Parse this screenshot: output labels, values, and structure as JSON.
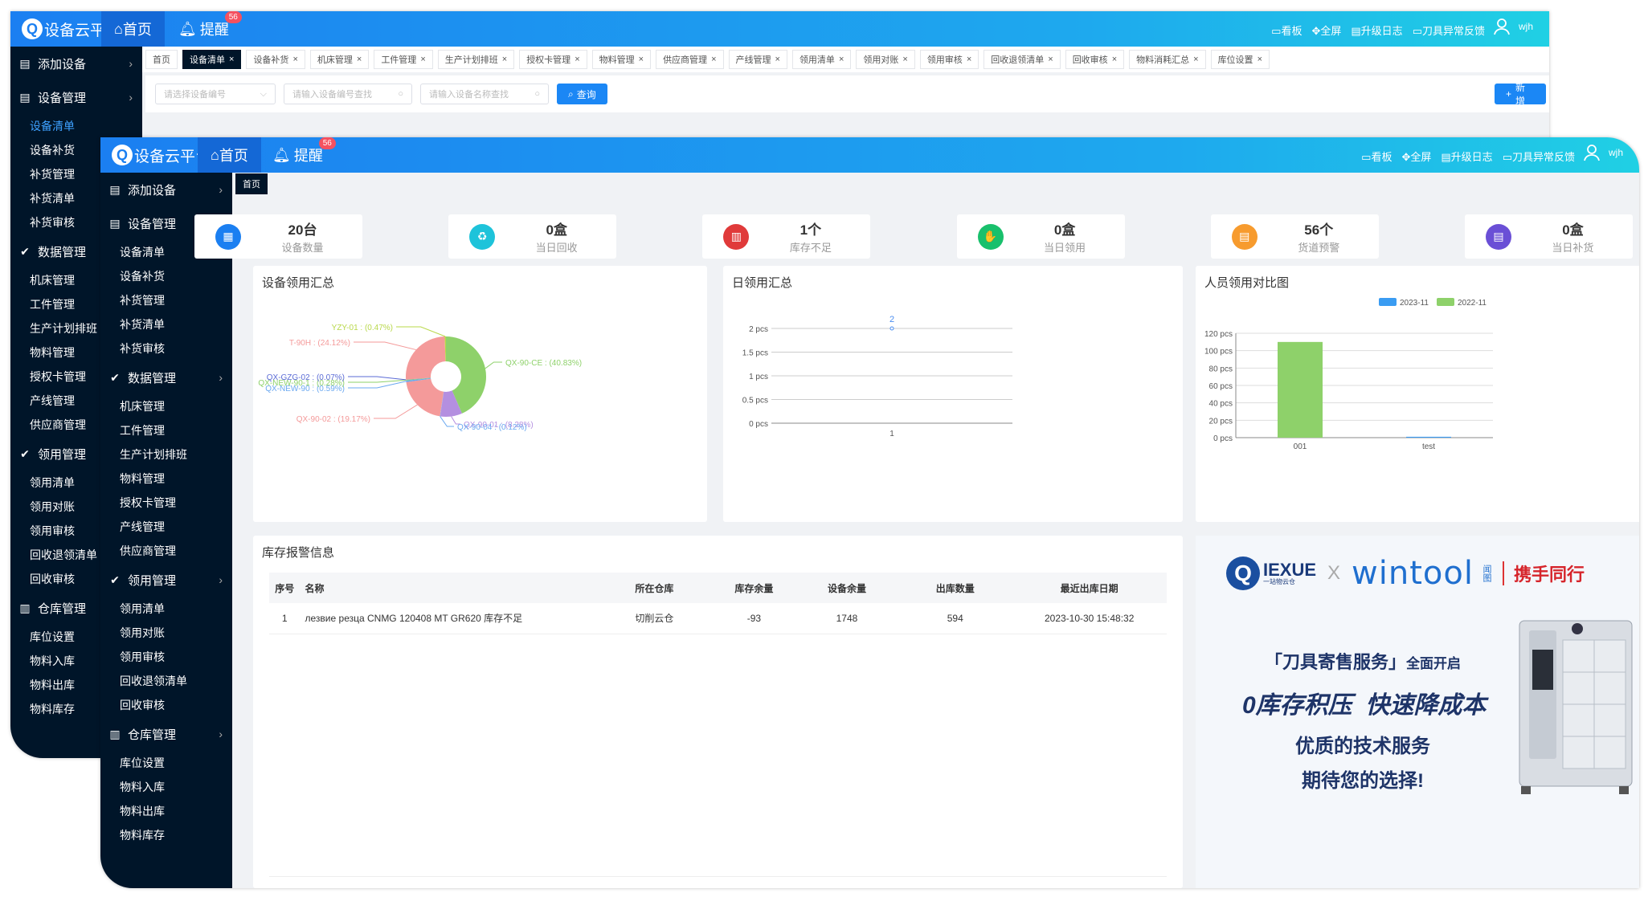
{
  "brand": {
    "name": "设备云平台",
    "home": "首页",
    "remind": "提醒",
    "remind_count": "56"
  },
  "toolbar": {
    "board": "看板",
    "fullscreen": "全屏",
    "log": "升级日志",
    "feedback": "刀具异常反馈",
    "user": "wjh"
  },
  "back_sidebar": [
    {
      "t": "group",
      "icon": "doc",
      "label": "添加设备",
      "chev": "›"
    },
    {
      "t": "group",
      "icon": "doc",
      "label": "设备管理",
      "chev": "›"
    },
    {
      "t": "child",
      "label": "设备清单",
      "active": true
    },
    {
      "t": "child",
      "label": "设备补货"
    },
    {
      "t": "child",
      "label": "补货管理"
    },
    {
      "t": "child",
      "label": "补货清单"
    },
    {
      "t": "child",
      "label": "补货审核"
    },
    {
      "t": "group",
      "icon": "check",
      "label": "数据管理"
    },
    {
      "t": "child",
      "label": "机床管理"
    },
    {
      "t": "child",
      "label": "工件管理"
    },
    {
      "t": "child",
      "label": "生产计划排班"
    },
    {
      "t": "child",
      "label": "物料管理"
    },
    {
      "t": "child",
      "label": "授权卡管理"
    },
    {
      "t": "child",
      "label": "产线管理"
    },
    {
      "t": "child",
      "label": "供应商管理"
    },
    {
      "t": "group",
      "icon": "check",
      "label": "领用管理"
    },
    {
      "t": "child",
      "label": "领用清单"
    },
    {
      "t": "child",
      "label": "领用对账"
    },
    {
      "t": "child",
      "label": "领用审核"
    },
    {
      "t": "child",
      "label": "回收退领清单"
    },
    {
      "t": "child",
      "label": "回收审核"
    },
    {
      "t": "group",
      "icon": "bank",
      "label": "仓库管理"
    },
    {
      "t": "child",
      "label": "库位设置"
    },
    {
      "t": "child",
      "label": "物料入库"
    },
    {
      "t": "child",
      "label": "物料出库"
    },
    {
      "t": "child",
      "label": "物料库存"
    }
  ],
  "back_tabs": [
    {
      "l": "首页",
      "x": false
    },
    {
      "l": "设备清单",
      "x": true,
      "active": true
    },
    {
      "l": "设备补货",
      "x": true
    },
    {
      "l": "机床管理",
      "x": true
    },
    {
      "l": "工件管理",
      "x": true
    },
    {
      "l": "生产计划排班",
      "x": true
    },
    {
      "l": "授权卡管理",
      "x": true
    },
    {
      "l": "物料管理",
      "x": true
    },
    {
      "l": "供应商管理",
      "x": true
    },
    {
      "l": "产线管理",
      "x": true
    },
    {
      "l": "领用清单",
      "x": true
    },
    {
      "l": "领用对账",
      "x": true
    },
    {
      "l": "领用审核",
      "x": true
    },
    {
      "l": "回收退领清单",
      "x": true
    },
    {
      "l": "回收审核",
      "x": true
    },
    {
      "l": "物料消耗汇总",
      "x": true
    },
    {
      "l": "库位设置",
      "x": true
    }
  ],
  "filter": {
    "device_select": "请选择设备编号",
    "device_no": "请输入设备编号查找",
    "device_name": "请输入设备名称查找",
    "query": "查询",
    "add": "新增"
  },
  "front_sidebar": [
    {
      "t": "group",
      "icon": "doc",
      "label": "添加设备",
      "chev": "›"
    },
    {
      "t": "group",
      "icon": "doc",
      "label": "设备管理",
      "chev": "›"
    },
    {
      "t": "child",
      "label": "设备清单"
    },
    {
      "t": "child",
      "label": "设备补货"
    },
    {
      "t": "child",
      "label": "补货管理"
    },
    {
      "t": "child",
      "label": "补货清单"
    },
    {
      "t": "child",
      "label": "补货审核"
    },
    {
      "t": "group",
      "icon": "check",
      "label": "数据管理",
      "chev": "›"
    },
    {
      "t": "child",
      "label": "机床管理"
    },
    {
      "t": "child",
      "label": "工件管理"
    },
    {
      "t": "child",
      "label": "生产计划排班"
    },
    {
      "t": "child",
      "label": "物料管理"
    },
    {
      "t": "child",
      "label": "授权卡管理"
    },
    {
      "t": "child",
      "label": "产线管理"
    },
    {
      "t": "child",
      "label": "供应商管理"
    },
    {
      "t": "group",
      "icon": "check",
      "label": "领用管理",
      "chev": "›"
    },
    {
      "t": "child",
      "label": "领用清单"
    },
    {
      "t": "child",
      "label": "领用对账"
    },
    {
      "t": "child",
      "label": "领用审核"
    },
    {
      "t": "child",
      "label": "回收退领清单"
    },
    {
      "t": "child",
      "label": "回收审核"
    },
    {
      "t": "group",
      "icon": "bank",
      "label": "仓库管理",
      "chev": "›"
    },
    {
      "t": "child",
      "label": "库位设置"
    },
    {
      "t": "child",
      "label": "物料入库"
    },
    {
      "t": "child",
      "label": "物料出库"
    },
    {
      "t": "child",
      "label": "物料库存"
    }
  ],
  "front_tab": "首页",
  "stats": [
    {
      "value": "20台",
      "label": "设备数量",
      "color": "#1b7ff1",
      "glyph": "▦"
    },
    {
      "value": "0盒",
      "label": "当日回收",
      "color": "#1ec3da",
      "glyph": "♻"
    },
    {
      "value": "1个",
      "label": "库存不足",
      "color": "#e03a3a",
      "glyph": "▥"
    },
    {
      "value": "0盒",
      "label": "当日领用",
      "color": "#19c06c",
      "glyph": "✋"
    },
    {
      "value": "56个",
      "label": "货道预警",
      "color": "#f79b2e",
      "glyph": "▤"
    },
    {
      "value": "0盒",
      "label": "当日补货",
      "color": "#6a4fd6",
      "glyph": "▤"
    }
  ],
  "charts": {
    "pie": {
      "title": "设备领用汇总"
    },
    "line": {
      "title": "日领用汇总"
    },
    "bar": {
      "title": "人员领用对比图"
    }
  },
  "chart_data": [
    {
      "type": "pie",
      "title": "设备领用汇总",
      "slices": [
        {
          "name": "QX-90-CE",
          "pct": 40.83,
          "label": "QX-90-CE : (40.83%)",
          "color": "#8ed16a"
        },
        {
          "name": "QX-90-01",
          "pct": 8.28,
          "label": "QX-90-01 : (8.28%)",
          "color": "#b48fe0"
        },
        {
          "name": "QX-90-04",
          "pct": 0.12,
          "label": "QX-90-04 : (0.12%)",
          "color": "#6aa8f0"
        },
        {
          "name": "QX-90-02",
          "pct": 19.17,
          "label": "QX-90-02 : (19.17%)",
          "color": "#f49a9a"
        },
        {
          "name": "QX-NEW-90",
          "pct": 0.59,
          "label": "QX-NEW-90 : (0.59%)",
          "color": "#6aa8f0"
        },
        {
          "name": "QX-NEW-90-1",
          "pct": 0.28,
          "label": "QX-NEW-90-1 : (0.28%)",
          "color": "#8ed16a"
        },
        {
          "name": "QX-GZG-02",
          "pct": 0.07,
          "label": "QX-GZG-02 : (0.07%)",
          "color": "#5b6bd6"
        },
        {
          "name": "T-90H",
          "pct": 24.12,
          "label": "T-90H : (24.12%)",
          "color": "#f49a9a"
        },
        {
          "name": "YZY-01",
          "pct": 0.47,
          "label": "YZY-01 : (0.47%)",
          "color": "#b9d84a"
        }
      ]
    },
    {
      "type": "line",
      "title": "日领用汇总",
      "x": [
        "1"
      ],
      "series": [
        {
          "values": [
            2
          ]
        }
      ],
      "ylim": [
        0,
        2
      ],
      "yticks": [
        "0 pcs",
        "0.5 pcs",
        "1 pcs",
        "1.5 pcs",
        "2 pcs"
      ]
    },
    {
      "type": "bar",
      "title": "人员领用对比图",
      "categories": [
        "001",
        "test"
      ],
      "series": [
        {
          "name": "2023-11",
          "values": [
            0,
            1
          ],
          "color": "#3a9cf2"
        },
        {
          "name": "2022-11",
          "values": [
            110,
            0
          ],
          "color": "#8ed16a"
        }
      ],
      "ylim": [
        0,
        120
      ],
      "yticks": [
        "0 pcs",
        "20 pcs",
        "40 pcs",
        "60 pcs",
        "80 pcs",
        "100 pcs",
        "120 pcs"
      ],
      "legend": "top-right"
    }
  ],
  "stock": {
    "title": "库存报警信息",
    "headers": [
      "序号",
      "名称",
      "所在仓库",
      "库存余量",
      "设备余量",
      "出库数量",
      "最近出库日期"
    ],
    "rows": [
      [
        "1",
        "лезвие резца CNMG 120408 MT GR620 库存不足",
        "切削云仓",
        "-93",
        "1748",
        "594",
        "2023-10-30 15:48:32"
      ]
    ]
  },
  "promo": {
    "brand1": "IEXUE",
    "brand1_sub": "一站物云仓",
    "cross": "X",
    "brand2": "wintool",
    "brand2_cn": "闻图",
    "slogan_top": "携手同行",
    "line1a": "「刀具寄售服务」",
    "line1b": "全面开启",
    "line2": "0库存积压  快速降成本",
    "line3": "优质的技术服务",
    "line4": "期待您的选择!"
  }
}
